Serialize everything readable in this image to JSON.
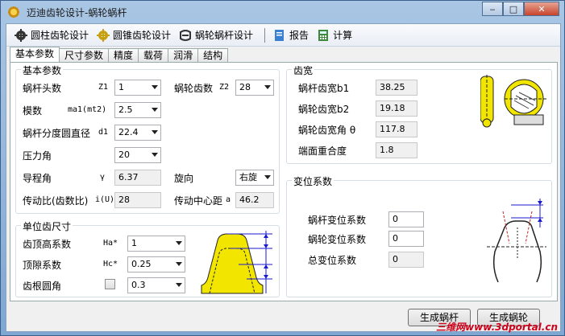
{
  "window": {
    "title": "迈迪齿轮设计-蜗轮蜗杆",
    "min": "‒",
    "max": "□",
    "close": "✕"
  },
  "menu": {
    "items": [
      {
        "label": "圆柱齿轮设计",
        "icon": "gear-icon"
      },
      {
        "label": "圆锥齿轮设计",
        "icon": "gear-icon"
      },
      {
        "label": "蜗轮蜗杆设计",
        "icon": "worm-icon"
      }
    ],
    "report": "报告",
    "calc": "计算"
  },
  "tabs": [
    "基本参数",
    "尺寸参数",
    "精度",
    "载荷",
    "润滑",
    "结构"
  ],
  "basic": {
    "title": "基本参数",
    "worm_starts": {
      "label": "蜗杆头数",
      "sym": "Z1",
      "value": "1"
    },
    "gear_teeth": {
      "label": "蜗轮齿数",
      "sym": "Z2",
      "value": "28"
    },
    "module": {
      "label": "模数",
      "sym": "ma1(mt2)",
      "value": "2.5"
    },
    "pitch_dia": {
      "label": "蜗杆分度圆直径",
      "sym": "d1",
      "value": "22.4"
    },
    "pressure_angle": {
      "label": "压力角",
      "value": "20"
    },
    "lead_angle": {
      "label": "导程角",
      "sym": "γ",
      "value": "6.37"
    },
    "hand": {
      "label": "旋向",
      "value": "右旋"
    },
    "ratio": {
      "label": "传动比(齿数比)",
      "sym": "i(U)",
      "value": "28"
    },
    "center_dist": {
      "label": "传动中心距",
      "sym": "a",
      "value": "46.2"
    }
  },
  "unit": {
    "title": "单位齿尺寸",
    "addendum": {
      "label": "齿顶高系数",
      "sym": "Ha*",
      "value": "1"
    },
    "clearance": {
      "label": "顶隙系数",
      "sym": "Hc*",
      "value": "0.25"
    },
    "fillet": {
      "label": "齿根圆角",
      "value": "0.3"
    }
  },
  "width": {
    "title": "齿宽",
    "b1": {
      "label": "蜗杆齿宽b1",
      "value": "38.25"
    },
    "b2": {
      "label": "蜗轮齿宽b2",
      "value": "19.18"
    },
    "theta": {
      "label": "蜗轮齿宽角 θ",
      "value": "117.8"
    },
    "overlap": {
      "label": "端面重合度",
      "value": "1.8"
    }
  },
  "shift": {
    "title": "变位系数",
    "worm": {
      "label": "蜗杆变位系数",
      "value": "0"
    },
    "gear": {
      "label": "蜗轮变位系数",
      "value": "0"
    },
    "total": {
      "label": "总变位系数",
      "value": "0"
    }
  },
  "buttons": {
    "gen_worm": "生成蜗杆",
    "gen_gear": "生成蜗轮"
  },
  "watermark": "三维网www.3dportal.cn"
}
